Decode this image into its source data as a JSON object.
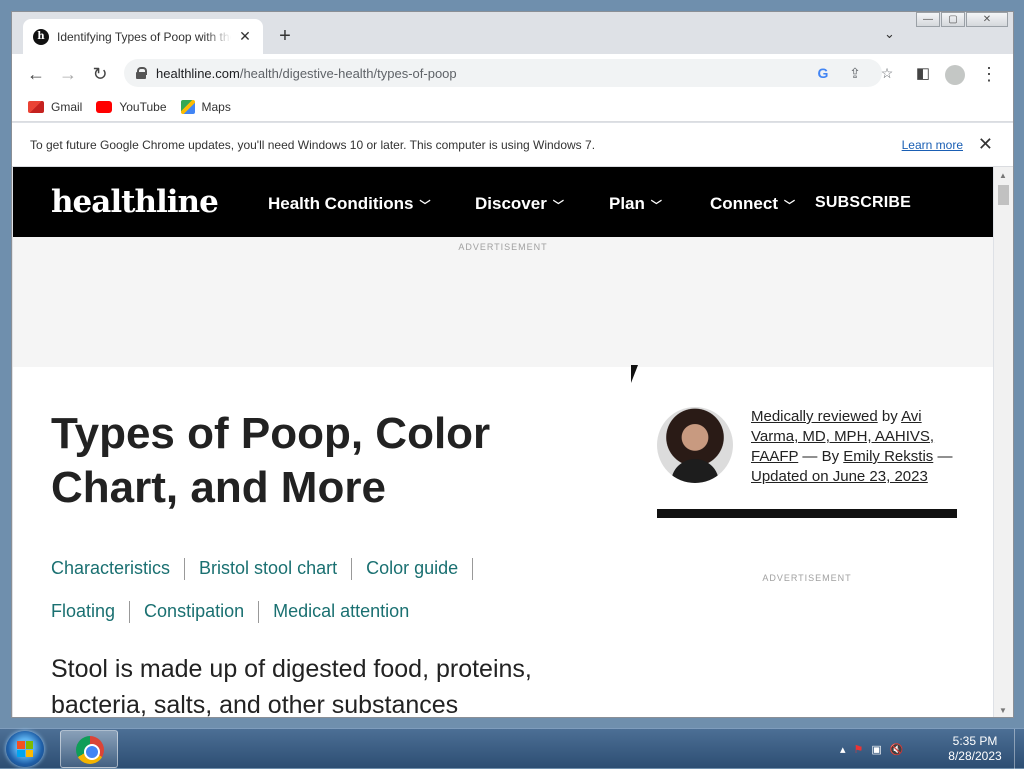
{
  "browser": {
    "tab_title": "Identifying Types of Poop with the",
    "tab_favicon_letter": "h",
    "url_host": "healthline.com",
    "url_path": "/health/digestive-health/types-of-poop"
  },
  "bookmarks": [
    {
      "label": "Gmail",
      "color": "#ea4335"
    },
    {
      "label": "YouTube",
      "color": "#ff0000"
    },
    {
      "label": "Maps",
      "color": "#34a853"
    }
  ],
  "infobar": {
    "message": "To get future Google Chrome updates, you'll need Windows 10 or later. This computer is using Windows 7.",
    "learn_more": "Learn more"
  },
  "site": {
    "logo": "healthline",
    "nav": [
      "Health Conditions",
      "Discover",
      "Plan",
      "Connect"
    ],
    "subscribe": "SUBSCRIBE",
    "ad_label": "ADVERTISEMENT"
  },
  "article": {
    "title": "Types of Poop, Color Chart, and More",
    "toc_row1": [
      "Characteristics",
      "Bristol stool chart",
      "Color guide"
    ],
    "toc_row2": [
      "Floating",
      "Constipation",
      "Medical attention"
    ],
    "lead": "Stool is made up of digested food, proteins, bacteria, salts, and other substances",
    "byline": {
      "medically_reviewed": "Medically reviewed",
      "by1": " by ",
      "reviewer": "Avi Varma, MD, MPH, AAHIVS, FAAFP",
      "by2": " — By ",
      "author": "Emily Rekstis",
      "dash": " — ",
      "updated": "Updated on June 23, 2023"
    }
  },
  "taskbar": {
    "time": "5:35 PM",
    "date": "8/28/2023"
  }
}
